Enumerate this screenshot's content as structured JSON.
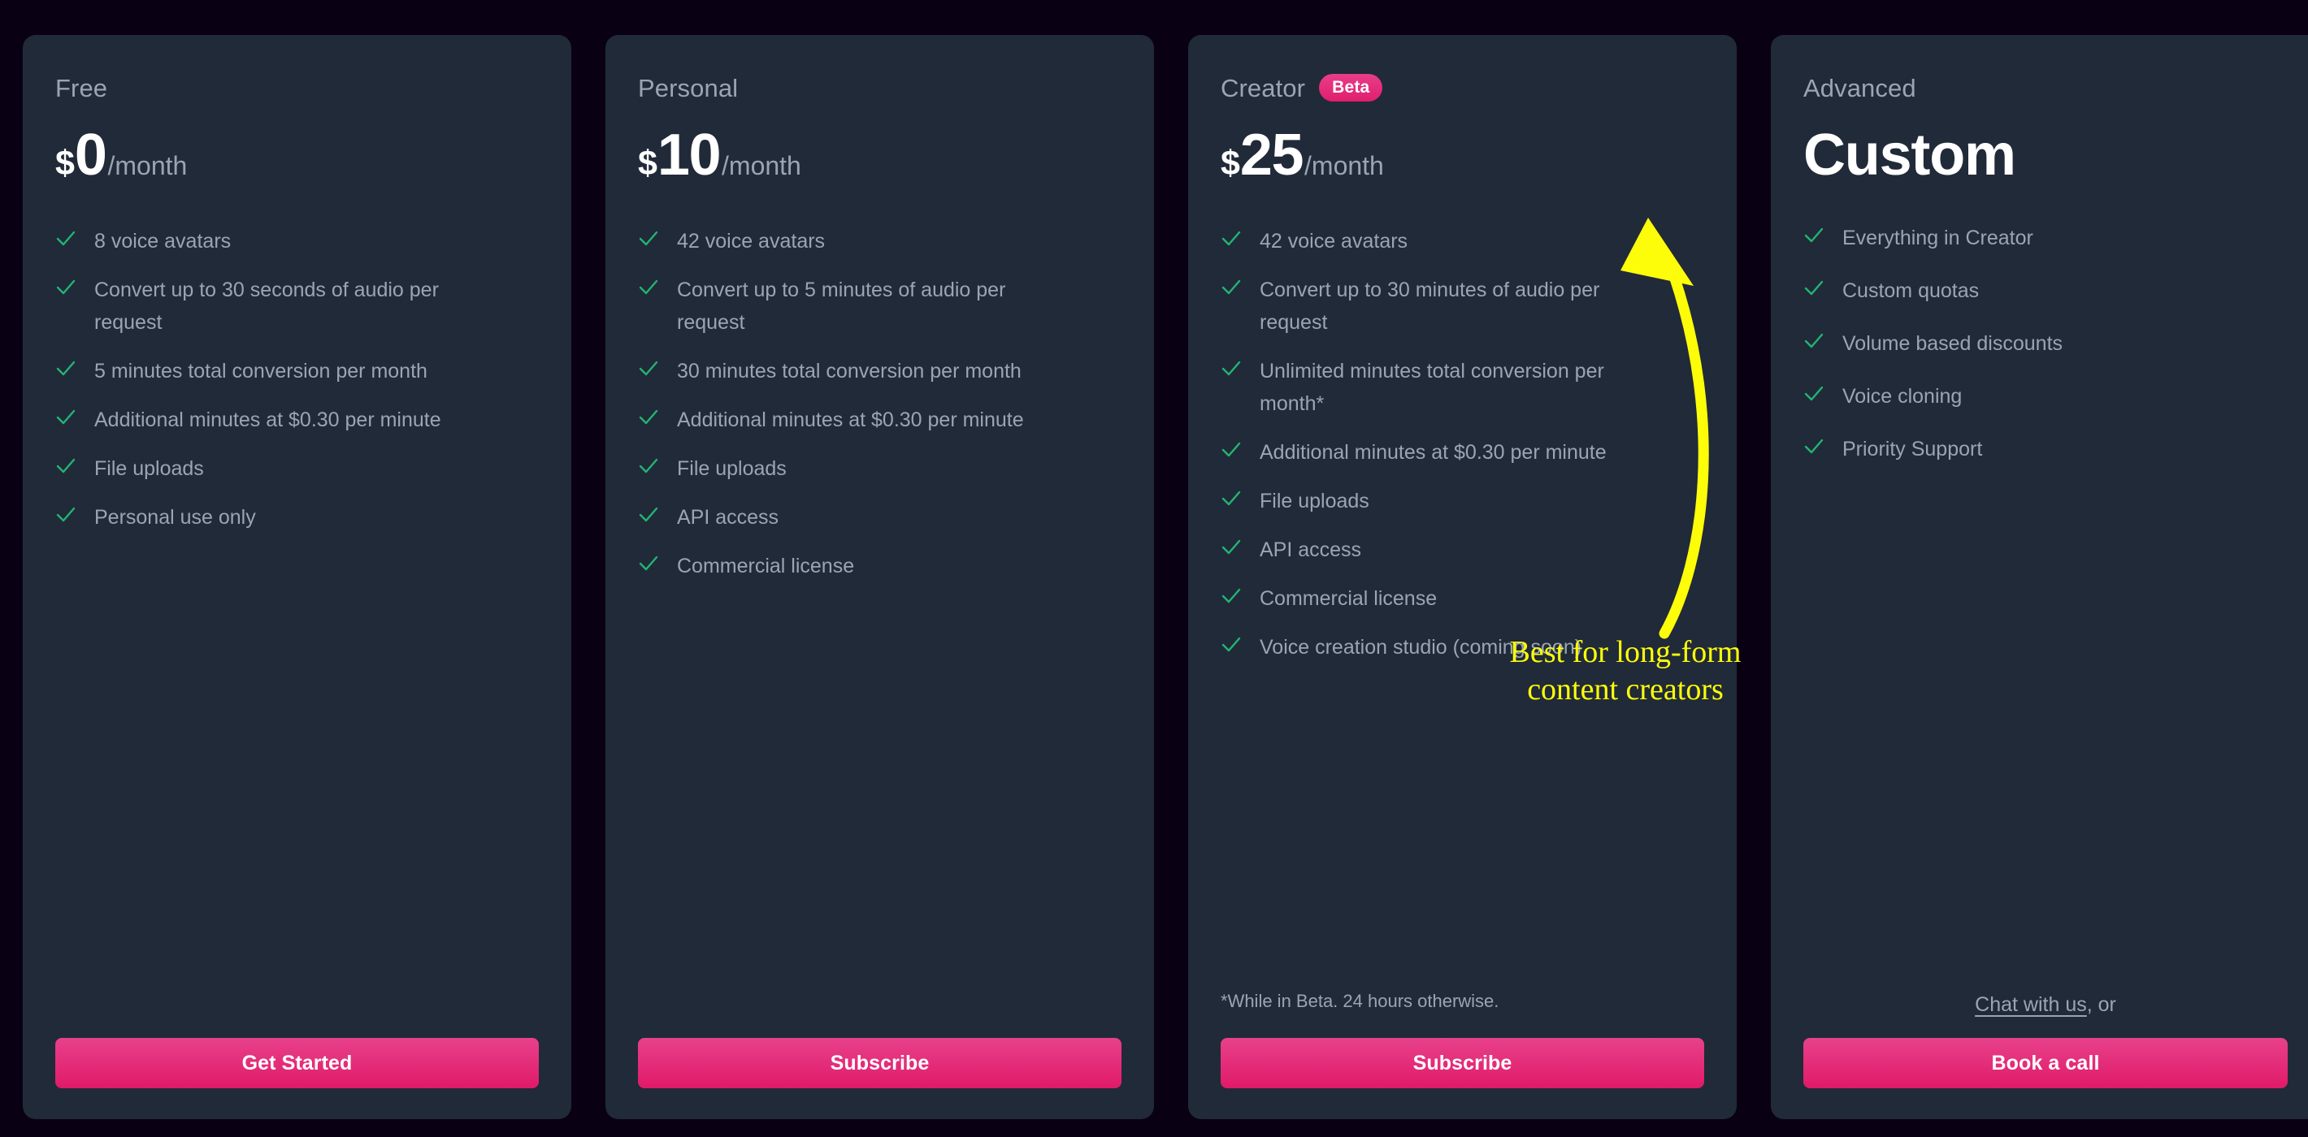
{
  "colors": {
    "page_background": "#0a0014",
    "card_background": "#212a38",
    "accent_pink": "#e01a68",
    "check_green": "#22b473",
    "muted_text": "#9aa5b4",
    "annotation_yellow": "#fdfd0a"
  },
  "plans": [
    {
      "name": "Free",
      "badge": null,
      "price": {
        "currency": "$",
        "amount": "0",
        "period": "/month",
        "custom": null
      },
      "features": [
        "8 voice avatars",
        "Convert up to 30 seconds of audio per request",
        "5 minutes total conversion per month",
        "Additional minutes at $0.30 per minute",
        "File uploads",
        "Personal use only"
      ],
      "footnote": null,
      "chat_link": null,
      "chat_suffix": null,
      "cta_label": "Get Started"
    },
    {
      "name": "Personal",
      "badge": null,
      "price": {
        "currency": "$",
        "amount": "10",
        "period": "/month",
        "custom": null
      },
      "features": [
        "42 voice avatars",
        "Convert up to 5 minutes of audio per request",
        "30 minutes total conversion per month",
        "Additional minutes at $0.30 per minute",
        "File uploads",
        "API access",
        "Commercial license"
      ],
      "footnote": null,
      "chat_link": null,
      "chat_suffix": null,
      "cta_label": "Subscribe"
    },
    {
      "name": "Creator",
      "badge": "Beta",
      "price": {
        "currency": "$",
        "amount": "25",
        "period": "/month",
        "custom": null
      },
      "features": [
        "42 voice avatars",
        "Convert up to 30 minutes of audio per request",
        "Unlimited minutes total conversion per month*",
        "Additional minutes at $0.30 per minute",
        "File uploads",
        "API access",
        "Commercial license",
        "Voice creation studio (coming soon)"
      ],
      "footnote": "*While in Beta. 24 hours otherwise.",
      "chat_link": null,
      "chat_suffix": null,
      "cta_label": "Subscribe"
    },
    {
      "name": "Advanced",
      "badge": null,
      "price": {
        "currency": null,
        "amount": null,
        "period": null,
        "custom": "Custom"
      },
      "features": [
        "Everything in Creator",
        "Custom quotas",
        "Volume based discounts",
        "Voice cloning",
        "Priority Support"
      ],
      "footnote": null,
      "chat_link": "Chat with us",
      "chat_suffix": ", or",
      "cta_label": "Book a call"
    }
  ],
  "annotation": {
    "text_line_1": "Best for long-form",
    "text_line_2": "content creators",
    "arrow": "curved-arrow-up-left"
  }
}
